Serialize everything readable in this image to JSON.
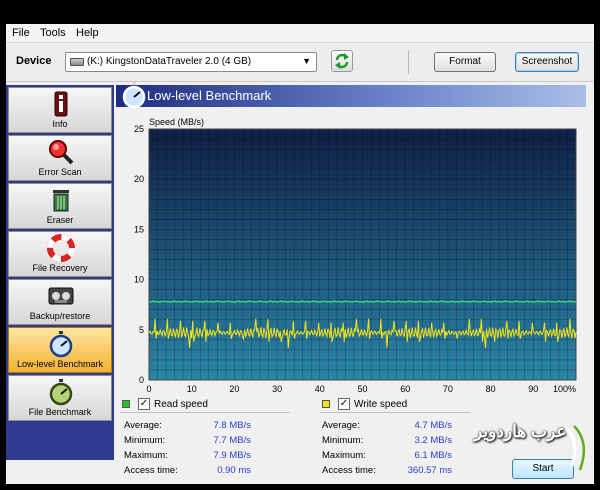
{
  "menu": [
    "File",
    "Tools",
    "Help"
  ],
  "toolbar": {
    "device_label": "Device",
    "device_value": "(K:) KingstonDataTraveler 2.0 (4 GB)",
    "format_label": "Format",
    "screenshot_label": "Screenshot"
  },
  "sidebar": {
    "items": [
      {
        "label": "Info",
        "icon": "info-icon"
      },
      {
        "label": "Error Scan",
        "icon": "magnifier-icon"
      },
      {
        "label": "Eraser",
        "icon": "trash-icon"
      },
      {
        "label": "File Recovery",
        "icon": "lifebuoy-icon"
      },
      {
        "label": "Backup/restore",
        "icon": "tape-icon"
      },
      {
        "label": "Low-level Benchmark",
        "icon": "stopwatch-icon",
        "active": true
      },
      {
        "label": "File Benchmark",
        "icon": "stopwatch-icon"
      }
    ]
  },
  "page": {
    "title": "Low-level Benchmark"
  },
  "colors": {
    "read": "#f4e21a",
    "write": "#2fe07a",
    "legend_read": "#22c32a",
    "legend_write": "#f4e21a",
    "plot_top": "#0f1f44",
    "plot_bottom": "#2b86a8",
    "sidebar_bg": "#2e3b8f",
    "active_item": "#f2b233"
  },
  "chart_data": {
    "type": "line",
    "ylabel": "Speed (MB/s)",
    "ylim": [
      0,
      25
    ],
    "yticks": [
      "0",
      "5",
      "10",
      "15",
      "20",
      "25"
    ],
    "xlim": [
      0,
      100
    ],
    "xticks": [
      "0",
      "10",
      "20",
      "30",
      "40",
      "50",
      "60",
      "70",
      "80",
      "90",
      "100%"
    ],
    "series": [
      {
        "name": "Read speed",
        "color": "#f4e21a",
        "average": 4.7,
        "min": 3.2,
        "max": 6.1,
        "peaks": 34
      },
      {
        "name": "Write speed",
        "color": "#2fe07a",
        "average": 7.8,
        "min": 7.7,
        "max": 7.9
      }
    ],
    "grid": true
  },
  "stats": {
    "read": {
      "label": "Read speed",
      "checked": true,
      "average_label": "Average:",
      "average": "7.8 MB/s",
      "minimum_label": "Minimum:",
      "minimum": "7.7 MB/s",
      "maximum_label": "Maximum:",
      "maximum": "7.9 MB/s",
      "access_label": "Access time:",
      "access": "0.90 ms"
    },
    "write": {
      "label": "Write speed",
      "checked": true,
      "average_label": "Average:",
      "average": "4.7 MB/s",
      "minimum_label": "Minimum:",
      "minimum": "3.2 MB/s",
      "maximum_label": "Maximum:",
      "maximum": "6.1 MB/s",
      "access_label": "Access time:",
      "access": "360.57 ms"
    }
  },
  "buttons": {
    "start": "Start"
  },
  "watermark": {
    "text": "عرب هاردوير"
  }
}
